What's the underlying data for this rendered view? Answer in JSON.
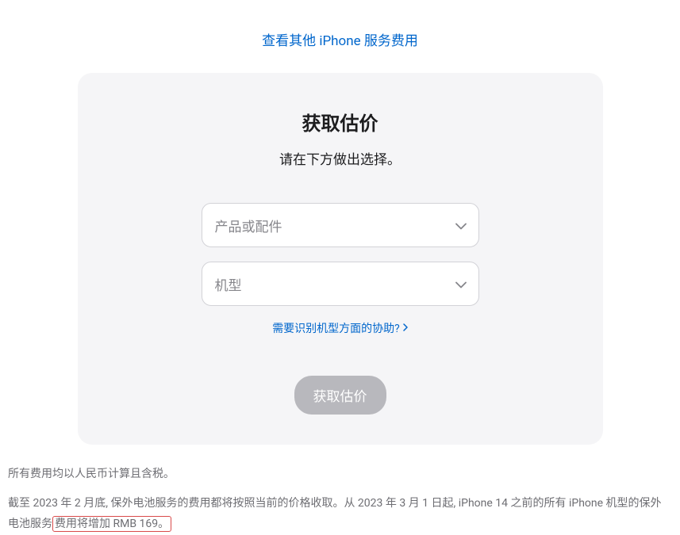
{
  "topLink": "查看其他 iPhone 服务费用",
  "card": {
    "title": "获取估价",
    "subtitle": "请在下方做出选择。",
    "productSelect": "产品或配件",
    "modelSelect": "机型",
    "helpLink": "需要识别机型方面的协助?",
    "submitButton": "获取估价"
  },
  "footer": {
    "line1": "所有费用均以人民币计算且含税。",
    "line2_part1": "截至 2023 年 2 月底, 保外电池服务的费用都将按照当前的价格收取。从 2023 年 3 月 1 日起, iPhone 14 之前的所有 iPhone 机型的保外电池服务",
    "line2_highlight": "费用将增加 RMB 169。"
  }
}
